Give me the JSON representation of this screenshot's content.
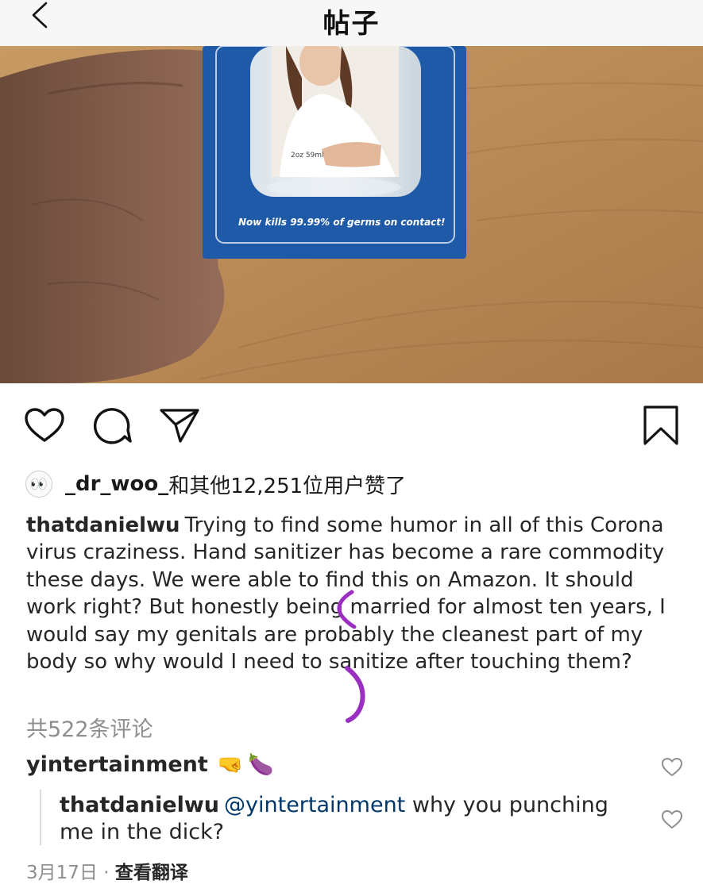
{
  "header": {
    "title": "帖子",
    "back_icon": "chevron-left-icon"
  },
  "photo": {
    "package_text": "Now kills 99.99% of germs on contact!",
    "bottle_label": "2oz 59ml"
  },
  "actions": {
    "like_icon": "heart-icon",
    "comment_icon": "comment-bubble-icon",
    "share_icon": "paper-plane-icon",
    "save_icon": "bookmark-icon"
  },
  "likes": {
    "avatar_emoji": "👀",
    "user": "_dr_woo_",
    "text": "和其他12,251位用户赞了"
  },
  "caption": {
    "username": "thatdanielwu",
    "text": "Trying to find some humor in all of this Corona virus craziness. Hand sanitizer has become a rare commodity these days. We were able to find this on Amazon. It should work right? But honestly being married for almost ten years, I would say my genitals are probably the cleanest part of my body so why would I need to sanitize after touching them?"
  },
  "comments": {
    "count_label": "共522条评论",
    "first": {
      "username": "yintertainment",
      "emojis": [
        "🤜",
        "🍆"
      ]
    },
    "reply": {
      "username": "thatdanielwu",
      "mention": "@yintertainment",
      "text": "why you punching me in the dick?"
    }
  },
  "meta": {
    "date": "3月17日",
    "separator": "·",
    "translate": "查看翻译"
  },
  "colors": {
    "annotation": "#9b2fc1",
    "package_blue": "#1f5aa8",
    "muted": "#8e8e8e"
  }
}
